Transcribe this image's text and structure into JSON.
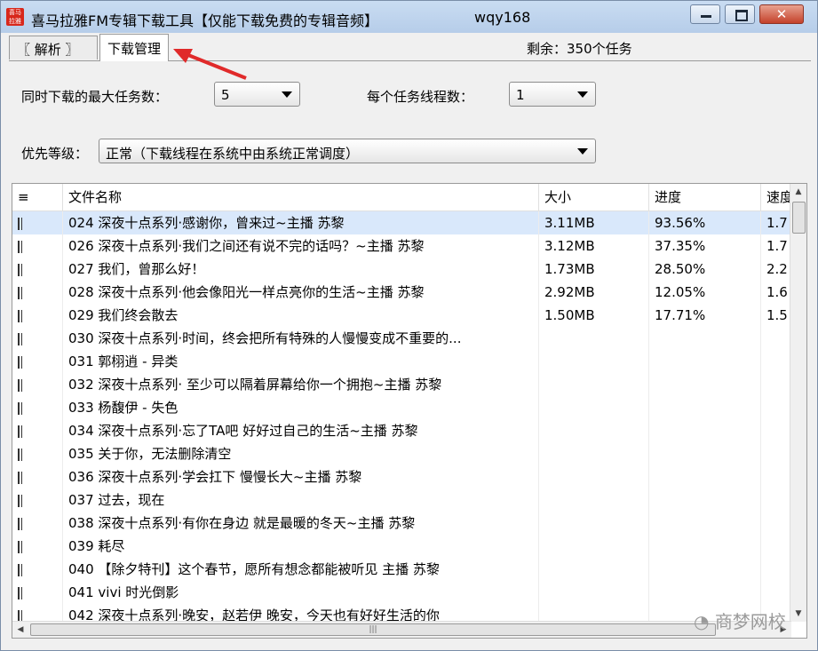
{
  "window": {
    "app_title": "喜马拉雅FM专辑下载工具【仅能下载免费的专辑音频】",
    "user": "wqy168",
    "close_glyph": "✕"
  },
  "tabs": [
    {
      "label": "〖 解析 〗",
      "active": false
    },
    {
      "label": "下载管理",
      "active": true
    }
  ],
  "remaining": "剩余：350个任务",
  "settings": {
    "max_tasks_label": "同时下载的最大任务数：",
    "max_tasks_value": "5",
    "threads_label": "每个任务线程数：",
    "threads_value": "1",
    "priority_label": "优先等级：",
    "priority_value": "正常（下载线程在系统中由系统正常调度）"
  },
  "table": {
    "headers": [
      "≡",
      "文件名称",
      "大小",
      "进度",
      "速度"
    ],
    "rows": [
      {
        "name": "024 深夜十点系列·感谢你，曾来过~主播 苏黎",
        "size": "3.11MB",
        "progress": "93.56%",
        "speed": "1.7",
        "selected": true
      },
      {
        "name": "026 深夜十点系列·我们之间还有说不完的话吗？~主播 苏黎",
        "size": "3.12MB",
        "progress": "37.35%",
        "speed": "1.7"
      },
      {
        "name": "027 我们，曾那么好！",
        "size": "1.73MB",
        "progress": "28.50%",
        "speed": "2.2"
      },
      {
        "name": "028 深夜十点系列·他会像阳光一样点亮你的生活~主播 苏黎",
        "size": "2.92MB",
        "progress": "12.05%",
        "speed": "1.6"
      },
      {
        "name": "029 我们终会散去",
        "size": "1.50MB",
        "progress": "17.71%",
        "speed": "1.5"
      },
      {
        "name": "030 深夜十点系列·时间，终会把所有特殊的人慢慢变成不重要的...",
        "size": "",
        "progress": "",
        "speed": ""
      },
      {
        "name": "031 郭栩逍 - 异类",
        "size": "",
        "progress": "",
        "speed": ""
      },
      {
        "name": "032 深夜十点系列· 至少可以隔着屏幕给你一个拥抱~主播 苏黎",
        "size": "",
        "progress": "",
        "speed": ""
      },
      {
        "name": "033 杨馥伊 - 失色",
        "size": "",
        "progress": "",
        "speed": ""
      },
      {
        "name": "034 深夜十点系列·忘了TA吧 好好过自己的生活~主播 苏黎",
        "size": "",
        "progress": "",
        "speed": ""
      },
      {
        "name": "035 关于你，无法删除清空",
        "size": "",
        "progress": "",
        "speed": ""
      },
      {
        "name": "036 深夜十点系列·学会扛下 慢慢长大~主播 苏黎",
        "size": "",
        "progress": "",
        "speed": ""
      },
      {
        "name": "037 过去，现在",
        "size": "",
        "progress": "",
        "speed": ""
      },
      {
        "name": "038 深夜十点系列·有你在身边 就是最暖的冬天~主播 苏黎",
        "size": "",
        "progress": "",
        "speed": ""
      },
      {
        "name": "039 耗尽",
        "size": "",
        "progress": "",
        "speed": ""
      },
      {
        "name": "040 【除夕特刊】这个春节，愿所有想念都能被听见 主播 苏黎",
        "size": "",
        "progress": "",
        "speed": ""
      },
      {
        "name": "041 vivi 时光倒影",
        "size": "",
        "progress": "",
        "speed": ""
      },
      {
        "name": "042 深夜十点系列·晚安，赵若伊 晚安，今天也有好好生活的你",
        "size": "",
        "progress": "",
        "speed": ""
      }
    ]
  },
  "watermark": "商梦网校",
  "colors": {
    "selected_row": "#d9e8fb",
    "arrow": "#e02a2a",
    "close_btn": "#c4412a"
  }
}
